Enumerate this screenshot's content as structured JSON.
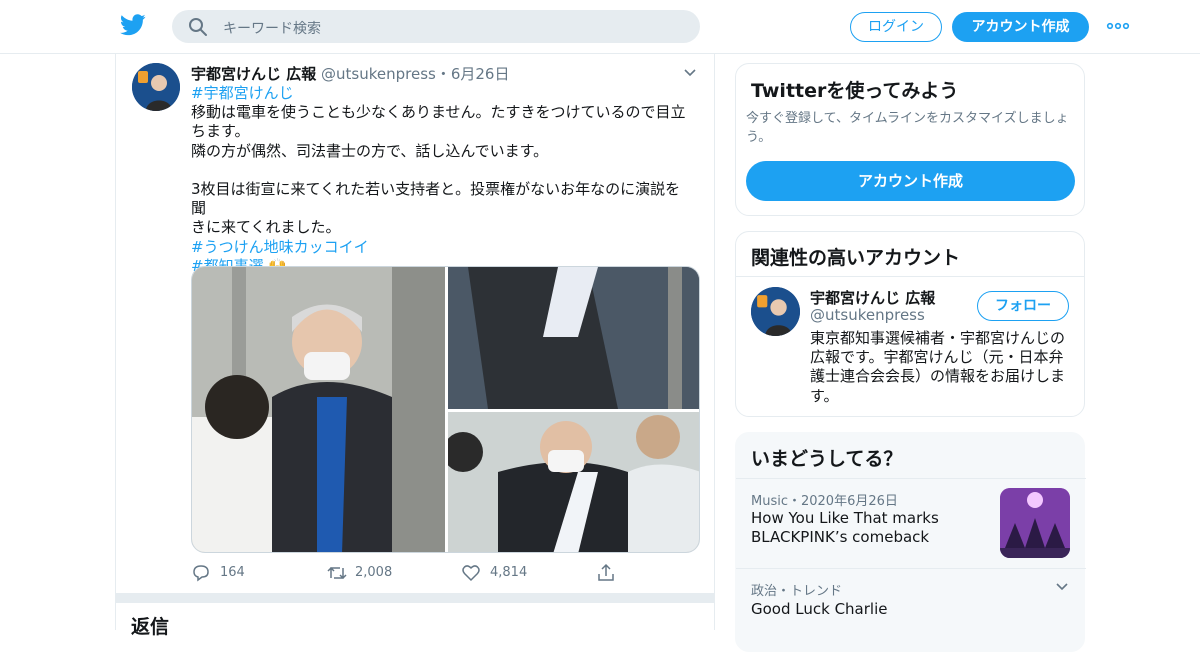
{
  "search": {
    "placeholder": "キーワード検索"
  },
  "header": {
    "login_label": "ログイン",
    "signup_label": "アカウント作成"
  },
  "tweet": {
    "name": "宇都宮けんじ 広報",
    "handle": "@utsukenpress",
    "date": "・6月26日",
    "lines": [
      "#宇都宮けんじ",
      "移動は電車を使うことも少なくありません。たすきをつけているので目立",
      "ちます。",
      "隣の方が偶然、司法書士の方で、話し込んでいます。",
      "",
      "3枚目は街宣に来てくれた若い支持者と。投票権がないお年なのに演説を聞",
      "きに来てくれました。",
      "#うつけん地味カッコイイ",
      "#都知事選"
    ],
    "replies": "164",
    "retweets": "2,008",
    "likes": "4,814"
  },
  "replies_heading": "返信",
  "signup_card": {
    "title": "Twitterを使ってみよう",
    "subtitle": "今すぐ登録して、タイムラインをカスタマイズしましょう。",
    "button": "アカウント作成"
  },
  "relevant_card": {
    "title": "関連性の高いアカウント",
    "name": "宇都宮けんじ 広報",
    "handle": "@utsukenpress",
    "follow": "フォロー",
    "bio": "東京都知事選候補者・宇都宮けんじの広報です。宇都宮けんじ（元・日本弁護士連合会会長）の情報をお届けします。"
  },
  "trends_card": {
    "title": "いまどうしてる？",
    "items": [
      {
        "meta": "Music・2020年6月26日",
        "headline": "How You Like That marks BLACKPINK’s comeback"
      },
      {
        "meta": "政治・トレンド",
        "headline": "Good Luck Charlie"
      }
    ]
  },
  "colors": {
    "accent": "#1da1f2",
    "border": "#e6ecf0",
    "muted": "#657786"
  }
}
